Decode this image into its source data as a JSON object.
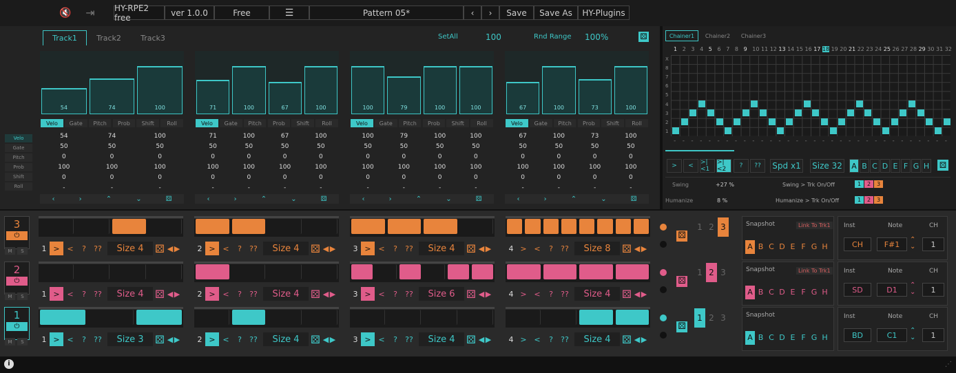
{
  "colors": {
    "teal": "#3ec8c8",
    "orange": "#e8843c",
    "pink": "#e05c8a"
  },
  "top": {
    "mute_icon": "speaker-mute-icon",
    "exit_icon": "exit-icon",
    "product": "HY-RPE2 free",
    "version": "ver 1.0.0",
    "edition": "Free",
    "menu_icon": "hamburger-icon",
    "pattern": "Pattern 05*",
    "save": "Save",
    "save_as": "Save As",
    "plugins": "HY-Plugins"
  },
  "seq": {
    "tabs": [
      "Track1",
      "Track2",
      "Track3"
    ],
    "setall": "SetAll",
    "setall_value": "100",
    "rnd_range": "Rnd Range",
    "rnd_value": "100%",
    "param_tabs": [
      "Velo",
      "Gate",
      "Pitch",
      "Prob",
      "Shift",
      "Roll"
    ],
    "side_labels": [
      "Velo",
      "Gate",
      "Pitch",
      "Prob",
      "Shift",
      "Roll"
    ],
    "groups": [
      {
        "velo": [
          54,
          74,
          100
        ],
        "rows": [
          [
            "54",
            "74",
            "100"
          ],
          [
            "50",
            "50",
            "50"
          ],
          [
            "0",
            "0",
            "0"
          ],
          [
            "100",
            "100",
            "100"
          ],
          [
            "0",
            "0",
            "0"
          ],
          [
            "-",
            "-",
            "-"
          ]
        ]
      },
      {
        "velo": [
          71,
          100,
          67,
          100
        ],
        "rows": [
          [
            "71",
            "100",
            "67",
            "100"
          ],
          [
            "50",
            "50",
            "50",
            "50"
          ],
          [
            "0",
            "0",
            "0",
            "0"
          ],
          [
            "100",
            "100",
            "100",
            "100"
          ],
          [
            "0",
            "0",
            "0",
            "0"
          ],
          [
            "-",
            "-",
            "-",
            "-"
          ]
        ]
      },
      {
        "velo": [
          100,
          79,
          100,
          100
        ],
        "rows": [
          [
            "100",
            "79",
            "100",
            "100"
          ],
          [
            "50",
            "50",
            "50",
            "50"
          ],
          [
            "0",
            "0",
            "0",
            "0"
          ],
          [
            "100",
            "100",
            "100",
            "100"
          ],
          [
            "0",
            "0",
            "0",
            "0"
          ],
          [
            "-",
            "-",
            "-",
            "-"
          ]
        ]
      },
      {
        "velo": [
          67,
          100,
          73,
          100
        ],
        "rows": [
          [
            "67",
            "100",
            "73",
            "100"
          ],
          [
            "50",
            "50",
            "50",
            "50"
          ],
          [
            "0",
            "0",
            "0",
            "0"
          ],
          [
            "100",
            "100",
            "100",
            "100"
          ],
          [
            "0",
            "0",
            "0",
            "0"
          ],
          [
            "-",
            "-",
            "-",
            "-"
          ]
        ]
      }
    ],
    "nav": [
      "‹",
      "›",
      "⌃",
      "⌄",
      "⚄"
    ]
  },
  "chainer": {
    "tabs": [
      "Chainer1",
      "Chainer2",
      "Chainer3"
    ],
    "cols": [
      "1",
      "2",
      "3",
      "4",
      "5",
      "6",
      "7",
      "8",
      "9",
      "10",
      "11",
      "12",
      "13",
      "14",
      "15",
      "16",
      "17",
      "18",
      "19",
      "20",
      "21",
      "22",
      "23",
      "24",
      "25",
      "26",
      "27",
      "28",
      "29",
      "30",
      "31",
      "32"
    ],
    "rows": [
      "X",
      "8",
      "7",
      "6",
      "5",
      "4",
      "3",
      "2",
      "1"
    ],
    "buttons": [
      ">",
      "<",
      ">|<1",
      ">|<2",
      "?",
      "??"
    ],
    "speed": "Spd x1",
    "size": "Size 32",
    "slots": [
      "A",
      "B",
      "C",
      "D",
      "E",
      "F",
      "G",
      "H"
    ],
    "swing_label": "Swing",
    "swing_value": "+27 %",
    "swing_link": "Swing > Trk On/Off",
    "humanize_label": "Humanize",
    "humanize_value": "8 %",
    "humanize_link": "Humanize > Trk On/Off",
    "trk_nums": [
      "1",
      "2",
      "3"
    ]
  },
  "tracks": [
    {
      "num": "3",
      "color": "#e8843c",
      "m": "M",
      "s": "S",
      "lanes": [
        {
          "n": "1",
          "size": "Size 4"
        },
        {
          "n": "2",
          "size": "Size 4"
        },
        {
          "n": "3",
          "size": "Size 4"
        },
        {
          "n": "4",
          "size": "Size 8"
        }
      ],
      "snap": "Snapshot",
      "link": "Link To Trk1",
      "inst_label": "Inst",
      "inst": "CH",
      "note_label": "Note",
      "note": "F#1",
      "ch_label": "CH",
      "ch": "1"
    },
    {
      "num": "2",
      "color": "#e05c8a",
      "m": "M",
      "s": "S",
      "lanes": [
        {
          "n": "1",
          "size": "Size 4"
        },
        {
          "n": "2",
          "size": "Size 4"
        },
        {
          "n": "3",
          "size": "Size 6"
        },
        {
          "n": "4",
          "size": "Size 4"
        }
      ],
      "snap": "Snapshot",
      "link": "Link To Trk1",
      "inst_label": "Inst",
      "inst": "SD",
      "note_label": "Note",
      "note": "D1",
      "ch_label": "CH",
      "ch": "1"
    },
    {
      "num": "1",
      "color": "#3ec8c8",
      "m": "M",
      "s": "S",
      "lanes": [
        {
          "n": "1",
          "size": "Size 3"
        },
        {
          "n": "2",
          "size": "Size 4"
        },
        {
          "n": "3",
          "size": "Size 4"
        },
        {
          "n": "4",
          "size": "Size 4"
        }
      ],
      "snap": "Snapshot",
      "link": "",
      "inst_label": "Inst",
      "inst": "BD",
      "note_label": "Note",
      "note": "C1",
      "ch_label": "CH",
      "ch": "1"
    }
  ],
  "lane_buttons": [
    ">",
    "<",
    "?",
    "??"
  ],
  "footer": {
    "info_icon": "info-icon"
  }
}
